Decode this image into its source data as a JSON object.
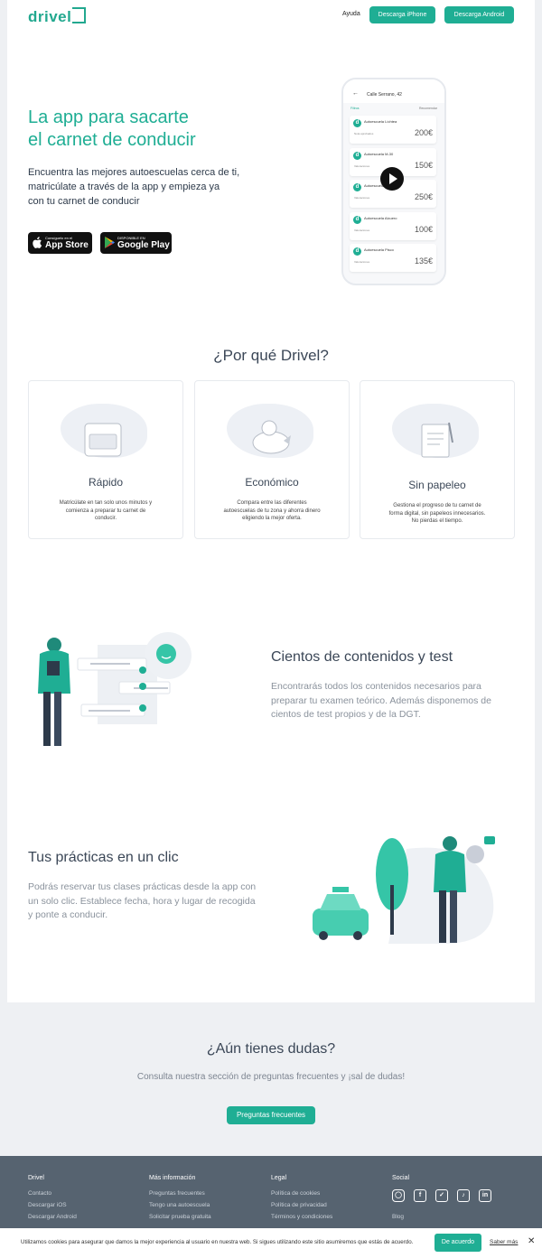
{
  "header": {
    "logo": "drivel",
    "help": "Ayuda",
    "btn_iphone": "Descarga iPhone",
    "btn_android": "Descarga Android"
  },
  "hero": {
    "title_line1": "La app para sacarte",
    "title_line2": "el carnet de conducir",
    "desc_line1": "Encuentra las mejores autoescuelas cerca de ti,",
    "desc_line2": "matricúlate a través de la app y empieza ya",
    "desc_line3": "con tu carnet de conducir",
    "appstore_small": "Consíguelo en el",
    "appstore_big": "App Store",
    "gplay_small": "DISPONIBLE EN",
    "gplay_big": "Google Play"
  },
  "phone": {
    "address": "Calle Serrano, 42",
    "filters": "Filtros",
    "sort": "Recomendar",
    "schools": [
      {
        "name": "Autoescuela Líchtea",
        "price": "200€"
      },
      {
        "name": "Autoescuela M-30",
        "price": "150€"
      },
      {
        "name": "Autoescuela",
        "price": "250€"
      },
      {
        "name": "Autoescuela Alcuero",
        "price": "100€"
      },
      {
        "name": "Autoescuela Pisco",
        "price": "135€"
      }
    ]
  },
  "why": {
    "title": "¿Por qué Drivel?",
    "features": [
      {
        "title": "Rápido",
        "text1": "Matricúlate en tan solo unos minutos y",
        "text2": "comienza a preparar tu carnet de",
        "text3": "conducir."
      },
      {
        "title": "Económico",
        "text1": "Compara entre las diferentes",
        "text2": "autoescuelas de tu zona y ahorra dinero",
        "text3": "eligiendo la mejor oferta."
      },
      {
        "title": "Sin papeleo",
        "text1": "Gestiona el progreso de tu carnet de",
        "text2": "forma digital, sin papeleos innecesarios.",
        "text3": "No pierdas el tiempo."
      }
    ]
  },
  "contents": {
    "title": "Cientos de contenidos y test",
    "text1": "Encontrarás todos los contenidos necesarios para",
    "text2": "preparar tu examen teórico. Además disponemos de",
    "text3": "cientos de test propios y de la DGT."
  },
  "practice": {
    "title": "Tus prácticas en un clic",
    "text1": "Podrás reservar tus clases prácticas desde la app con",
    "text2": "un solo clic. Establece fecha, hora y lugar de recogida",
    "text3": "y ponte a conducir."
  },
  "cta": {
    "title": "¿Aún tienes dudas?",
    "text": "Consulta nuestra sección de preguntas frecuentes y ¡sal de dudas!",
    "button": "Preguntas frecuentes"
  },
  "footer": {
    "col1_head": "Drivel",
    "col1": [
      "Contacto",
      "Descargar iOS",
      "Descargar Android"
    ],
    "col2_head": "Más información",
    "col2": [
      "Preguntas frecuentes",
      "Tengo una autoescuela",
      "Solicitar prueba gratuita"
    ],
    "col3_head": "Legal",
    "col3": [
      "Política de cookies",
      "Política de privacidad",
      "Términos y condiciones"
    ],
    "col4_head": "Social",
    "blog": "Blog"
  },
  "cookie": {
    "text": "Utilizamos cookies para asegurar que damos la mejor experiencia al usuario en nuestra web. Si sigues utilizando este sitio asumiremos que estás de acuerdo.",
    "accept": "De acuerdo",
    "more": "Saber más",
    "close": "✕"
  },
  "colors": {
    "brand": "#1fae94",
    "footer": "#566370",
    "band": "#eef0f3"
  }
}
